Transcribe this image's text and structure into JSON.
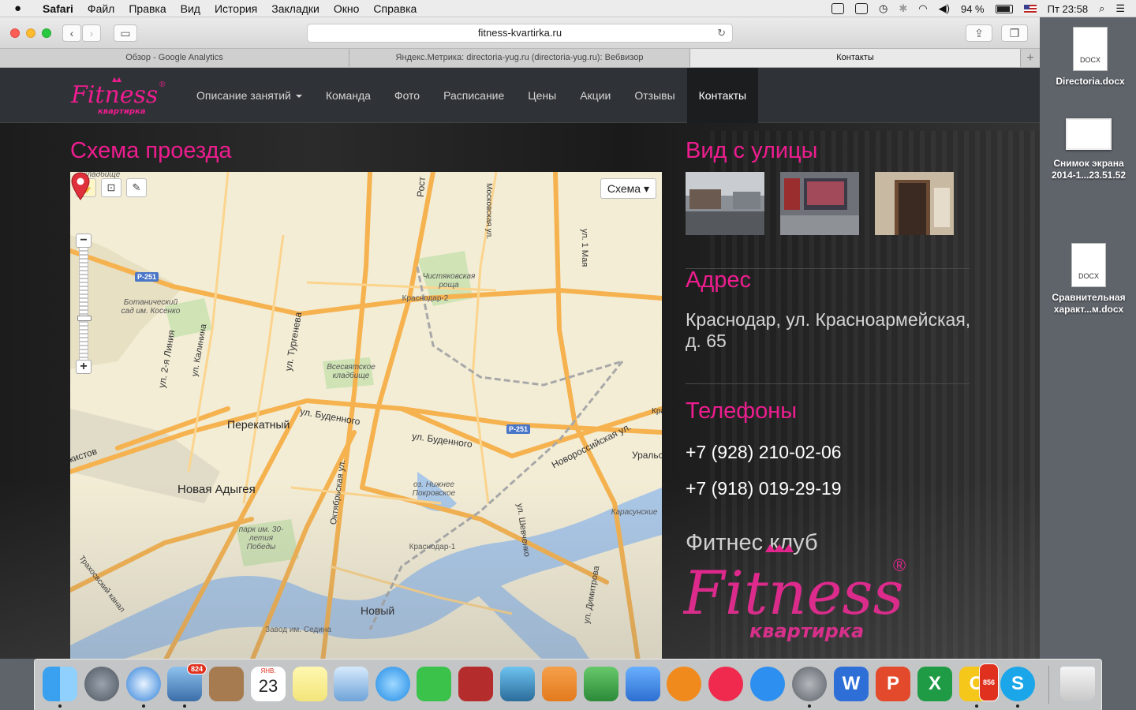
{
  "menubar": {
    "apple": "",
    "items": [
      "Safari",
      "Файл",
      "Правка",
      "Вид",
      "История",
      "Закладки",
      "Окно",
      "Справка"
    ],
    "battery": "94 %",
    "clock": "Пт 23:58"
  },
  "browser": {
    "url": "fitness-kvartirka.ru",
    "tabs": [
      {
        "label": "Обзор - Google Analytics"
      },
      {
        "label": "Яндекс.Метрика: directoria-yug.ru (directoria-yug.ru): Вебвизор"
      },
      {
        "label": "Контакты"
      }
    ],
    "new_tab": "+"
  },
  "site": {
    "logo_text": "Fitness",
    "logo_sub": "квартирка",
    "logo_mark": "®",
    "nav": [
      {
        "label": "Описание занятий"
      },
      {
        "label": "Команда"
      },
      {
        "label": "Фото"
      },
      {
        "label": "Расписание"
      },
      {
        "label": "Цены"
      },
      {
        "label": "Акции"
      },
      {
        "label": "Отзывы"
      },
      {
        "label": "Контакты"
      }
    ],
    "map_title": "Схема проезда",
    "street_title": "Вид с улицы",
    "address_title": "Адрес",
    "address": "Краснодар, ул. Красноармейская, д. 65",
    "phones_title": "Телефоны",
    "phones": [
      "+7 (928) 210-02-06",
      "+7 (918) 019-29-19"
    ],
    "club_title": "Фитнес клуб"
  },
  "map": {
    "type_button": "Схема ▾",
    "zoom_in": "+",
    "zoom_out": "−",
    "towns": [
      "Перекатный",
      "Новая Адыгея",
      "Новый"
    ],
    "streets": [
      "ул. Буденного",
      "ул. Буденного",
      "Новороссийская ул.",
      "ул. 2-я Линия",
      "ул. Калинина",
      "ул. Тургенева",
      "Октябрьская ул.",
      "ул. Шевченко",
      "ул. Димитрова",
      "ул. 1 Мая",
      "Московская ул.",
      "Трахосвский канал",
      "Рост",
      "кистов",
      "Уральская",
      "Кра"
    ],
    "pois": [
      "Ботанический сад им. Косенко",
      "Всесвятское кладбище",
      "Чистяковская роща",
      "Краснодар-2",
      "оз. Нижнее Покровское",
      "парк им. 30-летия Победы",
      "Карасунские",
      "Краснодар-1",
      "Завод им. Седина",
      "кладбище"
    ],
    "route_shields": [
      "Р-251",
      "Р-251"
    ]
  },
  "desktop": [
    {
      "label": "Directoria.docx",
      "badge": "DOCX"
    },
    {
      "label": "Снимок экрана 2014-1...23.51.52"
    },
    {
      "label": "Сравнительная характ...м.docx",
      "badge": "DOCX"
    }
  ],
  "dock": {
    "apps": [
      {
        "name": "Finder"
      },
      {
        "name": "Launchpad"
      },
      {
        "name": "Safari"
      },
      {
        "name": "Mail",
        "badge": "824"
      },
      {
        "name": "Contacts"
      },
      {
        "name": "Calendar",
        "month": "ЯНВ.",
        "day": "23"
      },
      {
        "name": "Notes"
      },
      {
        "name": "Preview"
      },
      {
        "name": "Messages"
      },
      {
        "name": "FaceTime"
      },
      {
        "name": "Photo Booth"
      },
      {
        "name": "iPhoto"
      },
      {
        "name": "Pages"
      },
      {
        "name": "Numbers"
      },
      {
        "name": "Keynote"
      },
      {
        "name": "iBooks"
      },
      {
        "name": "iTunes"
      },
      {
        "name": "App Store"
      },
      {
        "name": "System Preferences"
      },
      {
        "name": "Word",
        "glyph": "W"
      },
      {
        "name": "PowerPoint",
        "glyph": "P"
      },
      {
        "name": "Excel",
        "glyph": "X"
      },
      {
        "name": "Outlook",
        "glyph": "O",
        "badge": "856"
      },
      {
        "name": "Skype",
        "glyph": "S"
      },
      {
        "name": "Trash"
      }
    ]
  }
}
